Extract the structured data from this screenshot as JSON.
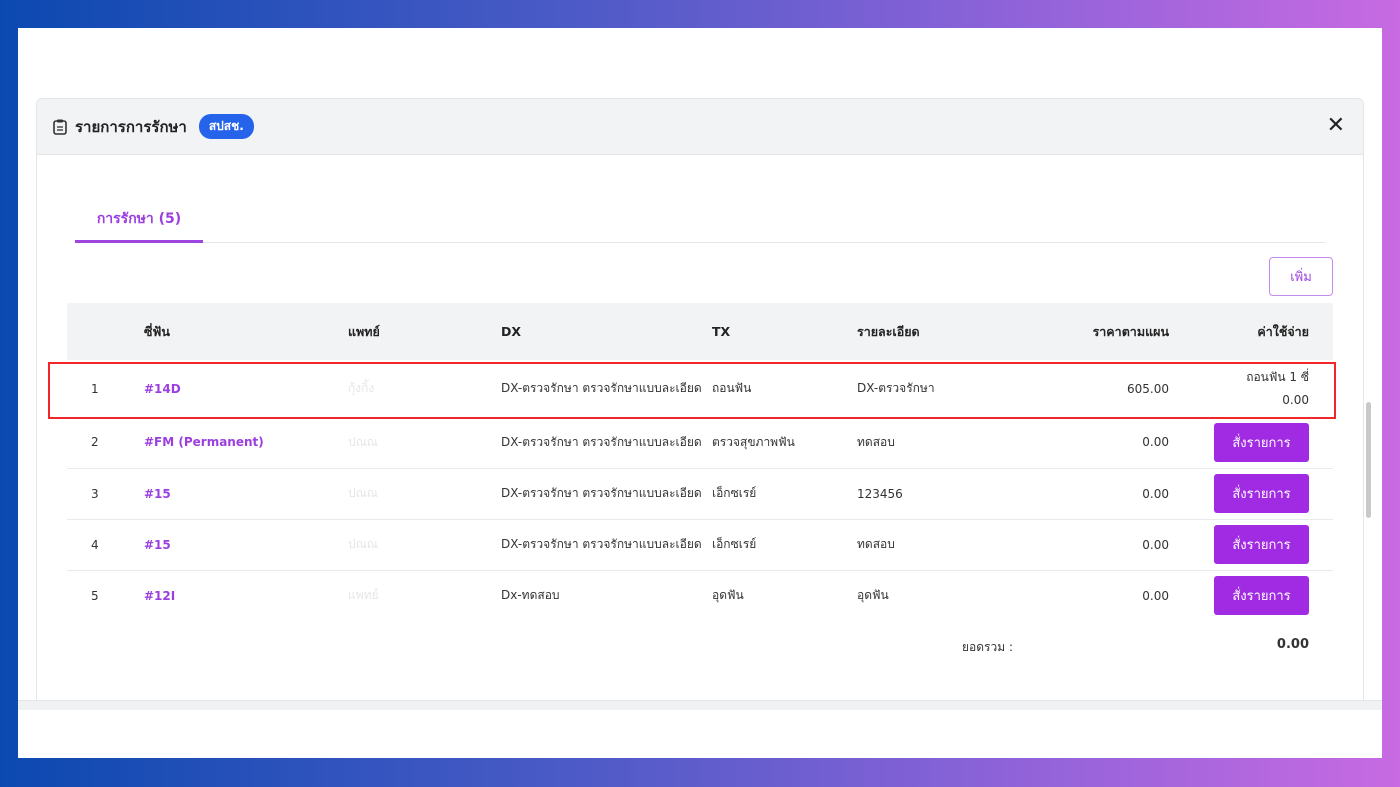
{
  "modal": {
    "title": "รายการการรักษา",
    "badge": "สปสช.",
    "close_icon": "close-icon",
    "header_icon": "clipboard-icon"
  },
  "tabs": [
    {
      "label": "การรักษา (5)",
      "active": true
    }
  ],
  "add_button": "เพิ่ม",
  "table": {
    "headers": [
      "",
      "ซี่ฟัน",
      "แพทย์",
      "DX",
      "TX",
      "รายละเอียด",
      "ราคาตามแผน",
      "ค่าใช้จ่าย"
    ],
    "rows": [
      {
        "no": "1",
        "tooth": "#14D",
        "doctor": "กุ้งกิ้ง",
        "dx": "DX-ตรวจรักษา ตรวจรักษาแบบละเอียด",
        "tx": "ถอนฟัน",
        "detail": "DX-ตรวจรักษา",
        "price": "605.00",
        "cost_note": "ถอนฟัน 1 ซี่",
        "cost": "0.00",
        "highlighted": true
      },
      {
        "no": "2",
        "tooth": "#FM (Permanent)",
        "doctor": "ปณณ",
        "dx": "DX-ตรวจรักษา ตรวจรักษาแบบละเอียด",
        "tx": "ตรวจสุขภาพฟัน",
        "detail": "ทดสอบ",
        "price": "0.00",
        "action": "สั่งรายการ"
      },
      {
        "no": "3",
        "tooth": "#15",
        "doctor": "ปณณ",
        "dx": "DX-ตรวจรักษา ตรวจรักษาแบบละเอียด",
        "tx": "เอ็กซเรย์",
        "detail": "123456",
        "price": "0.00",
        "action": "สั่งรายการ"
      },
      {
        "no": "4",
        "tooth": "#15",
        "doctor": "ปณณ",
        "dx": "DX-ตรวจรักษา ตรวจรักษาแบบละเอียด",
        "tx": "เอ็กซเรย์",
        "detail": "ทดสอบ",
        "price": "0.00",
        "action": "สั่งรายการ"
      },
      {
        "no": "5",
        "tooth": "#12I",
        "doctor": "แพทย์",
        "dx": "Dx-ทดสอบ",
        "tx": "อุดฟัน",
        "detail": "อุดฟัน",
        "price": "0.00",
        "action": "สั่งรายการ"
      }
    ]
  },
  "total": {
    "label": "ยอดรวม :",
    "value": "0.00"
  },
  "colors": {
    "accent": "#a12be3",
    "badge": "#2563eb",
    "highlight": "#f0262a"
  }
}
